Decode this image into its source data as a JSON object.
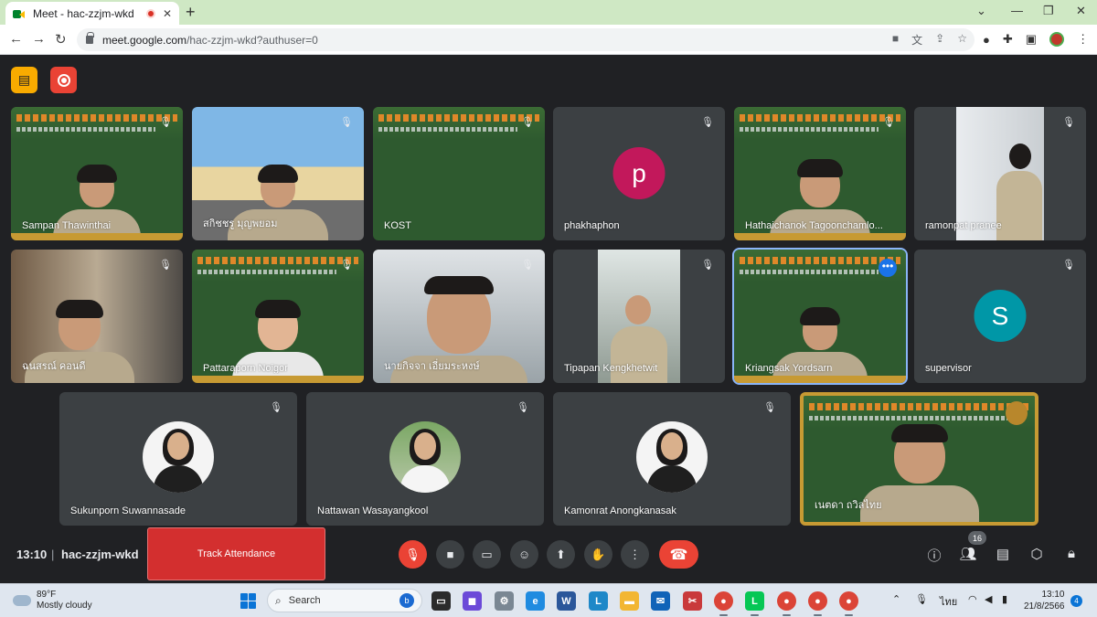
{
  "browser": {
    "tab_title": "Meet - hac-zzjm-wkd",
    "tab_close": "✕",
    "new_tab": "+",
    "url_host": "meet.google.com",
    "url_path": "/hac-zzjm-wkd?authuser=0"
  },
  "meeting": {
    "time": "13:10",
    "separator": "|",
    "code": "hac-zzjm-wkd",
    "track_attendance_label": "Track Attendance",
    "participant_count": "16"
  },
  "participants": [
    {
      "name": "Sampan Thawinthai"
    },
    {
      "name": "สกิชชรู มุญพยอม"
    },
    {
      "name": "KOST"
    },
    {
      "name": "phakhaphon",
      "initial": "p",
      "avatar_color": "#c2185b"
    },
    {
      "name": "Hathaichanok Tagoonchamlo..."
    },
    {
      "name": "ramonpat pranee"
    },
    {
      "name": "ฉนสรณ์ คอนดี"
    },
    {
      "name": "Pattaraporn Noigor"
    },
    {
      "name": "นายกิจจา เอี่ยมระหงษ์"
    },
    {
      "name": "Tipapan Kengkhetwit"
    },
    {
      "name": "Kriangsak Yordsarn"
    },
    {
      "name": "supervisor",
      "initial": "S",
      "avatar_color": "#0097a7"
    },
    {
      "name": "Sukunporn Suwannasade"
    },
    {
      "name": "Nattawan Wasayangkool"
    },
    {
      "name": "Kamonrat Anongkanasak"
    },
    {
      "name": "เนตดา ถวิลไทย"
    }
  ],
  "taskbar": {
    "temperature": "89°F",
    "weather_text": "Mostly cloudy",
    "search_placeholder": "Search",
    "language": "ไทย",
    "clock_time": "13:10",
    "clock_date": "21/8/2566",
    "notification_count": "4"
  },
  "colors": {
    "meet_bg": "#202124",
    "tile_bg": "#3c4043",
    "danger": "#ea4335",
    "accent": "#1a73e8"
  }
}
